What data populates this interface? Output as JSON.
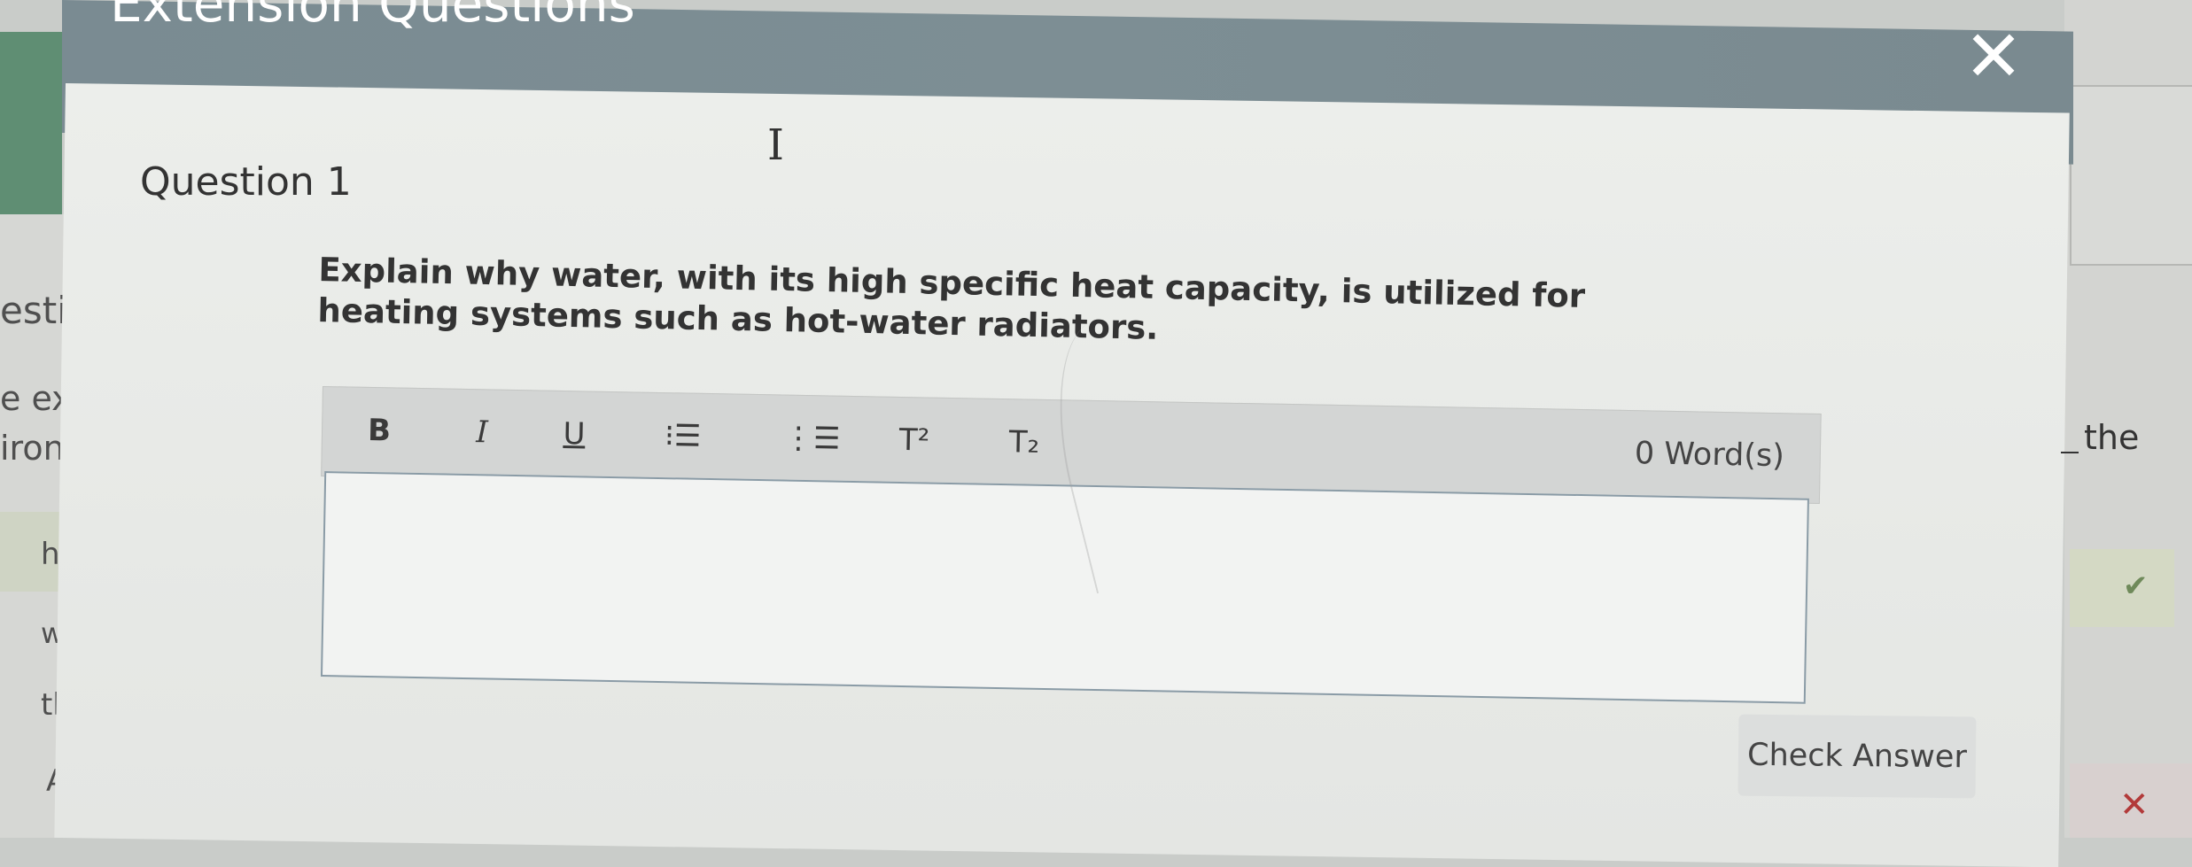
{
  "modal": {
    "title": "Extension Questions",
    "close_label": "✕"
  },
  "question": {
    "title": "Question 1",
    "prompt": "Explain why water, with its high specific heat capacity, is utilized for heating systems such as hot-water radiators."
  },
  "editor": {
    "toolbar": {
      "bold": "B",
      "italic": "I",
      "underline": "U",
      "bullet_list": "⁝☰",
      "numbered_list": "⋮☰",
      "superscript": "T²",
      "subscript": "T₂"
    },
    "word_count": "0 Word(s)",
    "value": ""
  },
  "actions": {
    "check_answer": "Check Answer"
  },
  "background_page": {
    "left_fragments": [
      "esti",
      "e exp",
      "iron",
      "he",
      "w",
      "th",
      "Al"
    ],
    "right_fragment": "the",
    "right_check": "✔",
    "right_x": "✕"
  }
}
